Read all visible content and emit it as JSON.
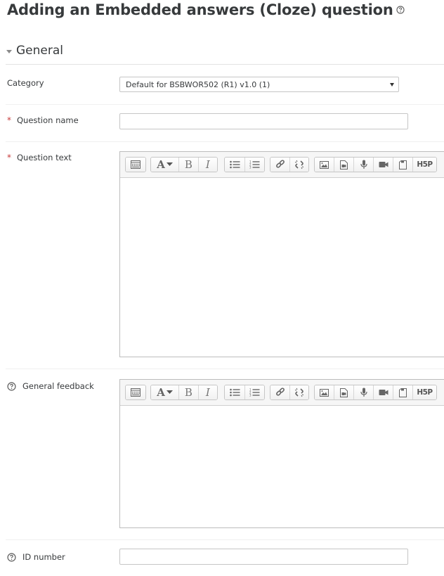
{
  "page": {
    "title": "Adding an Embedded answers (Cloze) question"
  },
  "section": {
    "title": "General"
  },
  "fields": {
    "category": {
      "label": "Category",
      "value": "Default for BSBWOR502 (R1) v1.0 (1)"
    },
    "question_name": {
      "label": "Question name",
      "value": ""
    },
    "question_text": {
      "label": "Question text",
      "value": ""
    },
    "general_feedback": {
      "label": "General feedback",
      "value": ""
    },
    "id_number": {
      "label": "ID number",
      "value": ""
    }
  },
  "icons": {
    "required": "*",
    "help": "question-circle-icon",
    "section_toggle": "caret-down-icon"
  },
  "toolbar": {
    "buttons": [
      "toolbar-toggle-icon",
      "font-style-icon",
      "bold-icon",
      "italic-icon",
      "unordered-list-icon",
      "ordered-list-icon",
      "link-icon",
      "unlink-icon",
      "image-icon",
      "media-icon",
      "record-audio-icon",
      "record-video-icon",
      "manage-files-icon",
      "h5p-icon"
    ]
  },
  "colors": {
    "required": "#c73b3b",
    "text": "#373a3c",
    "toolbar_bg": "#f6f6f6"
  }
}
